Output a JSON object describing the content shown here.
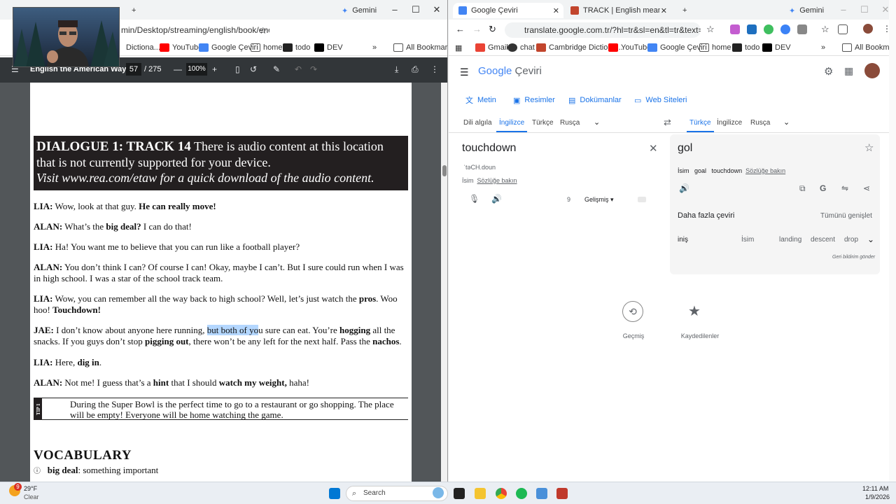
{
  "left_window": {
    "tabs": [
      {
        "label": "Gemini"
      }
    ],
    "url_text": "min/Desktop/streaming/english/book/engli...",
    "bookmarks": [
      "Dictiona...",
      "YouTube",
      "Google Çeviri",
      "home",
      "todo",
      "DEV",
      "All Bookmarks"
    ],
    "pdf": {
      "title": "English the American Way",
      "page_current": "57",
      "page_total": "/ 275",
      "zoom": "100%"
    },
    "document": {
      "track_heading": "DIALOGUE 1: TRACK 14",
      "track_notice1": "There is audio content at this location that is not currently supported for your device.",
      "track_notice2": "Visit www.rea.com/etaw for a quick download of the audio content.",
      "lines": [
        {
          "speaker": "LIA:",
          "text": "Wow, look at that guy.",
          "bold": "He can really move!",
          "rest": ""
        },
        {
          "speaker": "ALAN:",
          "text": "What’s the",
          "bold": "big deal?",
          "rest": "I can do that!"
        },
        {
          "speaker": "LIA:",
          "text": "Ha! You want me to believe that you can run like a football player?",
          "bold": "",
          "rest": ""
        },
        {
          "speaker": "ALAN:",
          "text": "You don’t think I can? Of course I can! Okay, maybe I can’t. But I sure could run when I was in high school. I was a star of the school track team.",
          "bold": "",
          "rest": ""
        }
      ],
      "lia_pros_a": "Wow, you can remember all the way back to high school? Well, let’s just watch the",
      "lia_pros_b": "pros",
      "lia_pros_c": ". Woo hoo!",
      "lia_pros_d": "Touchdown!",
      "jae_a": "I don’t know about anyone here running,",
      "jae_hl": "but both of yo",
      "jae_b": "u sure can eat. You’re",
      "jae_c": "hogging",
      "jae_d": "all the snacks. If you guys don’t stop",
      "jae_e": "pigging out",
      "jae_f": ", there won’t be any left for the next half. Pass the",
      "jae_g": "nachos",
      "jae_h": ".",
      "lia_dig_a": "Here,",
      "lia_dig_b": "dig in",
      "lia_dig_c": ".",
      "alan_end_a": "Not me! I guess that’s a",
      "alan_end_b": "hint",
      "alan_end_c": "that I should",
      "alan_end_d": "watch my weight,",
      "alan_end_e": "haha!",
      "tip_label": "TIP 1",
      "tip_text": "During the Super Bowl is the perfect time to go to a restaurant or go shopping. The place will be empty! Everyone will be home watching the game.",
      "vocab_heading": "VOCABULARY",
      "vocab_term": "big deal",
      "vocab_def": ": something important",
      "speakers": {
        "lia": "LIA:",
        "alan": "ALAN:",
        "jae": "JAE:"
      }
    }
  },
  "right_window": {
    "tabs": [
      {
        "label": "Google Çeviri"
      },
      {
        "label": "TRACK | English meaning - Cam"
      },
      {
        "label": "Gemini"
      }
    ],
    "url_text": "translate.google.com.tr/?hl=tr&sl=en&tl=tr&text=touchdo...",
    "bookmarks": [
      "Gmail",
      "chat",
      "Cambridge Dictiona...",
      "YouTube",
      "Google Çeviri",
      "home",
      "todo",
      "DEV",
      "All Bookmarks"
    ],
    "logo_google": "Google",
    "logo_product": "Çeviri",
    "mode_tabs": [
      "Metin",
      "Resimler",
      "Dokümanlar",
      "Web Siteleri"
    ],
    "source_langs": [
      "Dili algıla",
      "İngilizce",
      "Türkçe",
      "Rusça"
    ],
    "target_langs": [
      "Türkçe",
      "İngilizce",
      "Rusça"
    ],
    "source_text": "touchdown",
    "source_phonetic": "ˈtəCH.doun",
    "source_pos": "İsim",
    "source_dict_link": "Sözlüğe bakın",
    "char_count": "9",
    "advanced_label": "Gelişmiş",
    "target_text": "gol",
    "target_pos": "İsim",
    "target_alt1": "goal",
    "target_alt2": "touchdown",
    "target_dict_link": "Sözlüğe bakın",
    "more_translations": "Daha fazla çeviri",
    "expand_all": "Tümünü genişlet",
    "alt_word": "iniş",
    "alt_pos": "İsim",
    "alt_syn1": "landing",
    "alt_syn2": "descent",
    "alt_syn3": "drop",
    "feedback": "Geri bildirim gönder",
    "history_label": "Geçmiş",
    "saved_label": "Kaydedilenler"
  },
  "taskbar": {
    "weather_temp": "29°F",
    "weather_desc": "Clear",
    "weather_badge": "9",
    "search_placeholder": "Search",
    "time": "12:11 AM",
    "date": "1/9/2026"
  }
}
